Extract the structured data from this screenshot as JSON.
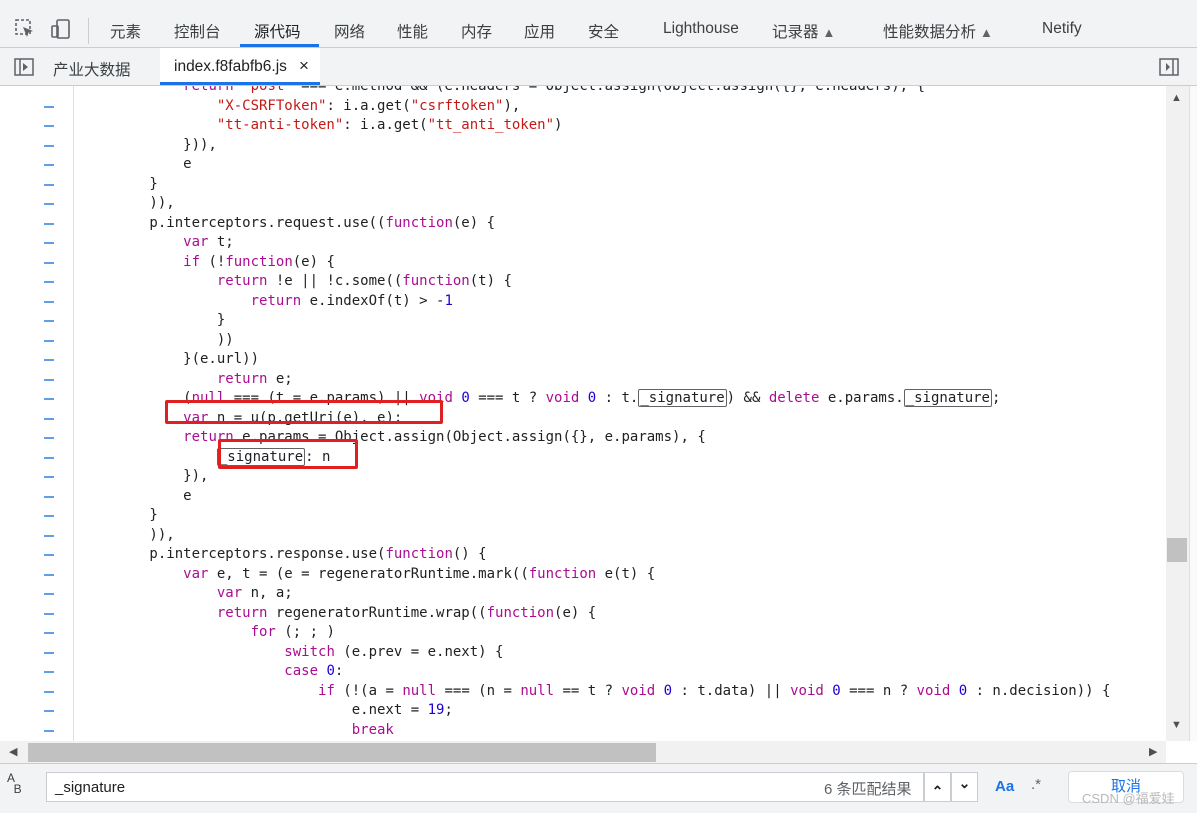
{
  "devtools_tabs": [
    {
      "label": "元素"
    },
    {
      "label": "控制台"
    },
    {
      "label": "源代码",
      "active": true
    },
    {
      "label": "网络"
    },
    {
      "label": "性能"
    },
    {
      "label": "内存"
    },
    {
      "label": "应用"
    },
    {
      "label": "安全"
    },
    {
      "label": "Lighthouse"
    },
    {
      "label": "记录器"
    },
    {
      "label": "性能数据分析"
    },
    {
      "label": "Netify"
    }
  ],
  "file_tabs": {
    "left_tab": "产业大数据",
    "active_file": "index.f8fabfb6.js",
    "close_glyph": "×"
  },
  "code_lines": [
    "            return \"post\" === e.method && (e.headers = Object.assign(Object.assign({}, e.headers), {",
    "                \"X-CSRFToken\": i.a.get(\"csrftoken\"),",
    "                \"tt-anti-token\": i.a.get(\"tt_anti_token\")",
    "            })),",
    "            e",
    "        }",
    "        )),",
    "        p.interceptors.request.use((function(e) {",
    "            var t;",
    "            if (!function(e) {",
    "                return !e || !c.some((function(t) {",
    "                    return e.indexOf(t) > -1",
    "                }",
    "                ))",
    "            }(e.url))",
    "                return e;",
    "            (null === (t = e.params) || void 0 === t ? void 0 : t._signature) && delete e.params._signature;",
    "            var n = u(p.getUri(e), e);",
    "            return e.params = Object.assign(Object.assign({}, e.params), {",
    "                _signature: n",
    "            }),",
    "            e",
    "        }",
    "        )),",
    "        p.interceptors.response.use(function() {",
    "            var e, t = (e = regeneratorRuntime.mark((function e(t) {",
    "                var n, a;",
    "                return regeneratorRuntime.wrap((function(e) {",
    "                    for (; ; )",
    "                        switch (e.prev = e.next) {",
    "                        case 0:",
    "                            if (!(a = null === (n = null == t ? void 0 : t.data) || void 0 === n ? void 0 : n.decision)) {",
    "                                e.next = 19;",
    "                                break",
    "                            }"
  ],
  "search": {
    "query": "_signature",
    "match_count": "6 条匹配结果",
    "match_case_label": "Aa",
    "regex_label": ".*",
    "cancel_label": "取消",
    "prev_glyph": "⌃",
    "next_glyph": "⌄"
  },
  "watermark": "CSDN @福爱娃",
  "colors": {
    "accent": "#1a73e8",
    "highlight_box": "#e02020",
    "keyword": "#aa0d91",
    "string": "#c41a16",
    "number": "#1c00cf"
  }
}
